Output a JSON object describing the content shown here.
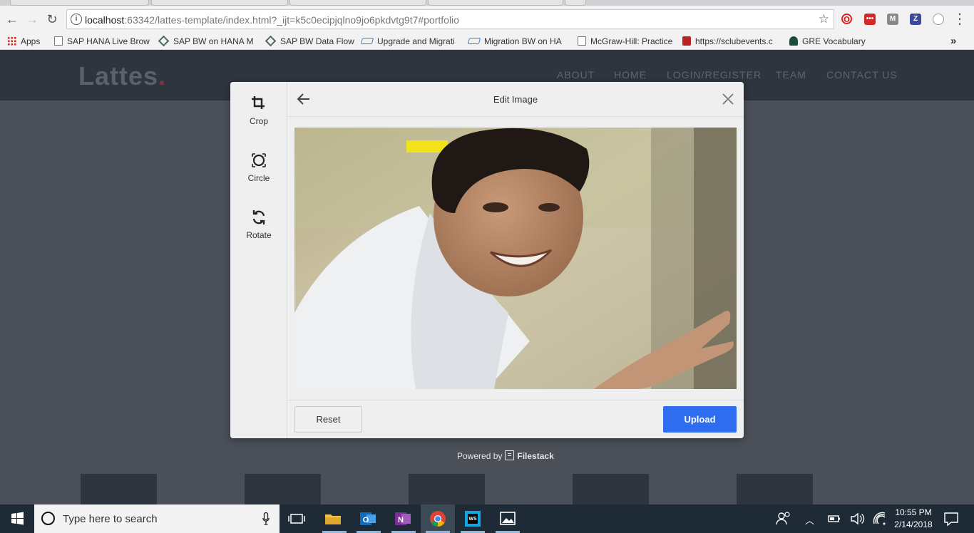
{
  "browser": {
    "url_host": "localhost",
    "url_rest": ":63342/lattes-template/index.html?_ijt=k5c0ecipjqlno9jo6pkdvtg9t7#portfolio",
    "bookmarks": [
      {
        "label": "Apps",
        "icon": "apps-grid-icon"
      },
      {
        "label": "SAP HANA Live Brow",
        "icon": "page-icon"
      },
      {
        "label": "SAP BW on HANA M",
        "icon": "diamond-icon"
      },
      {
        "label": "SAP BW Data Flow",
        "icon": "diamond-icon"
      },
      {
        "label": "Upgrade and Migrati",
        "icon": "sap-icon"
      },
      {
        "label": "Migration BW on HA",
        "icon": "sap-icon"
      },
      {
        "label": "McGraw-Hill: Practice",
        "icon": "page-icon"
      },
      {
        "label": "https://sclubevents.c",
        "icon": "club-icon"
      },
      {
        "label": "GRE Vocabulary",
        "icon": "spartan-icon"
      }
    ],
    "overflow": "»"
  },
  "site": {
    "logo": "Lattes",
    "logo_dot": ".",
    "nav": [
      "ABOUT",
      "HOME",
      "LOGIN/REGISTER",
      "TEAM",
      "CONTACT US"
    ]
  },
  "modal": {
    "title": "Edit Image",
    "tools": [
      {
        "label": "Crop",
        "icon": "crop-icon"
      },
      {
        "label": "Circle",
        "icon": "circle-icon"
      },
      {
        "label": "Rotate",
        "icon": "rotate-icon"
      }
    ],
    "reset_label": "Reset",
    "upload_label": "Upload",
    "powered_prefix": "Powered by",
    "powered_brand": "Filestack"
  },
  "taskbar": {
    "search_placeholder": "Type here to search",
    "time": "10:55 PM",
    "date": "2/14/2018"
  },
  "colors": {
    "accent": "#2f6df0",
    "header_bg": "#2f353e",
    "page_bg": "#4a4f58",
    "taskbar_bg": "#1e2a35"
  }
}
